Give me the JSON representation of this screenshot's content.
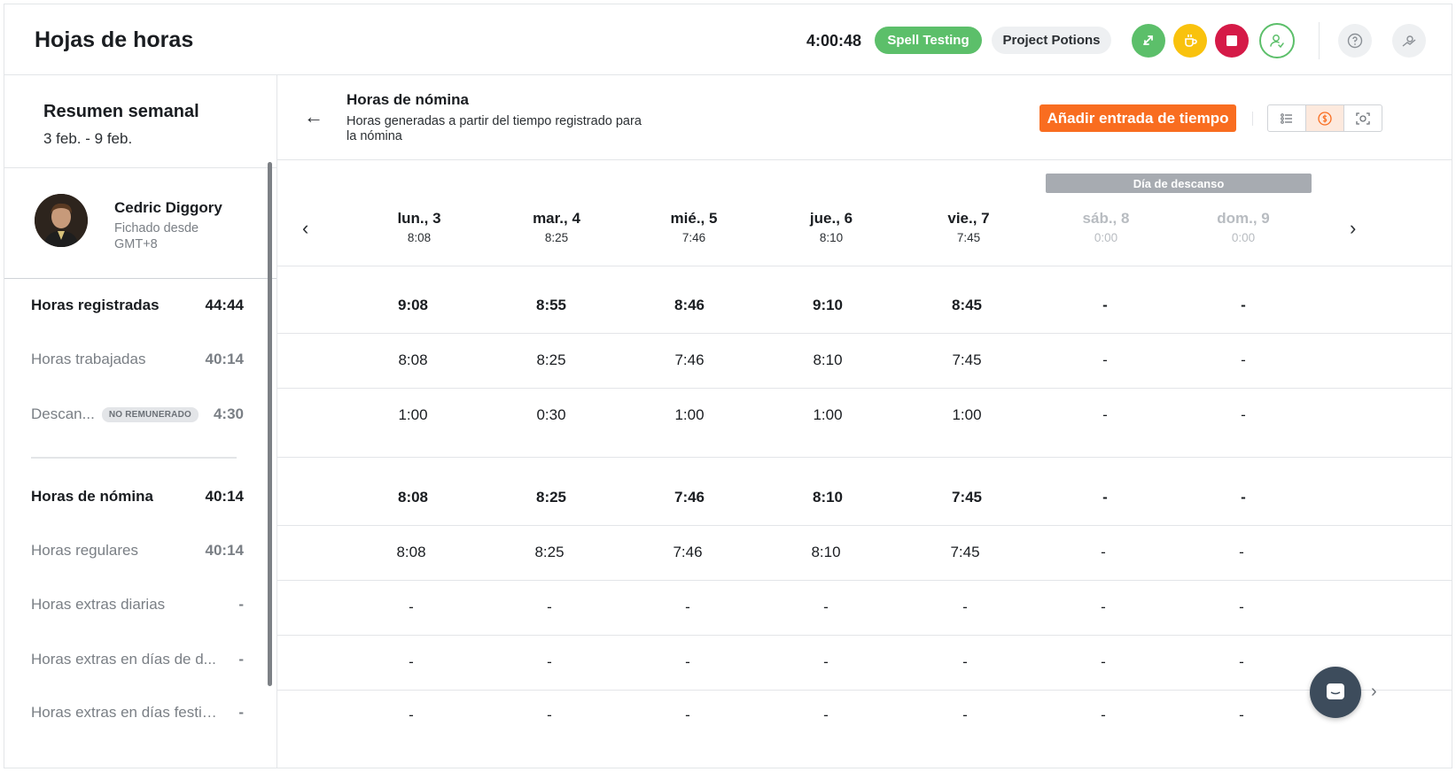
{
  "header": {
    "title": "Hojas de horas",
    "timer": "4:00:48",
    "activity_pill": "Spell Testing",
    "project_pill": "Project Potions",
    "colors": {
      "green": "#5cbf6a",
      "yellow": "#f9c20d",
      "red": "#d51a47",
      "orange": "#f96d20"
    }
  },
  "summary": {
    "title": "Resumen semanal",
    "range": "3 feb. - 9 feb.",
    "employee": {
      "name": "Cedric Diggory",
      "sub": "Fichado desde GMT+8"
    },
    "rows": [
      {
        "label": "Horas registradas",
        "value": "44:44"
      },
      {
        "label": "Horas trabajadas",
        "value": "40:14"
      },
      {
        "label": "Descan...",
        "badge": "NO REMUNERADO",
        "value": "4:30"
      },
      {
        "label": "Horas de nómina",
        "value": "40:14"
      },
      {
        "label": "Horas regulares",
        "value": "40:14"
      },
      {
        "label": "Horas extras diarias",
        "value": "-"
      },
      {
        "label": "Horas extras en días de d...",
        "value": "-"
      },
      {
        "label": "Horas extras en días festiv...",
        "value": "-"
      }
    ]
  },
  "main": {
    "title": "Horas de nómina",
    "description": "Horas generadas a partir del tiempo registrado para la nómina",
    "add_button": "Añadir entrada de tiempo",
    "day_off_label": "Día de descanso"
  },
  "days": [
    {
      "name": "lun., 3",
      "hours": "8:08"
    },
    {
      "name": "mar., 4",
      "hours": "8:25"
    },
    {
      "name": "mié., 5",
      "hours": "7:46"
    },
    {
      "name": "jue., 6",
      "hours": "8:10"
    },
    {
      "name": "vie., 7",
      "hours": "7:45"
    },
    {
      "name": "sáb., 8",
      "hours": "0:00"
    },
    {
      "name": "dom., 9",
      "hours": "0:00"
    }
  ],
  "grid": [
    [
      "9:08",
      "8:55",
      "8:46",
      "9:10",
      "8:45",
      "-",
      "-"
    ],
    [
      "8:08",
      "8:25",
      "7:46",
      "8:10",
      "7:45",
      "-",
      "-"
    ],
    [
      "1:00",
      "0:30",
      "1:00",
      "1:00",
      "1:00",
      "-",
      "-"
    ],
    [
      "8:08",
      "8:25",
      "7:46",
      "8:10",
      "7:45",
      "-",
      "-"
    ],
    [
      "8:08",
      "8:25",
      "7:46",
      "8:10",
      "7:45",
      "-",
      "-"
    ],
    [
      "-",
      "-",
      "-",
      "-",
      "-",
      "-",
      "-"
    ],
    [
      "-",
      "-",
      "-",
      "-",
      "-",
      "-",
      "-"
    ],
    [
      "-",
      "-",
      "-",
      "-",
      "-",
      "-",
      "-"
    ]
  ]
}
